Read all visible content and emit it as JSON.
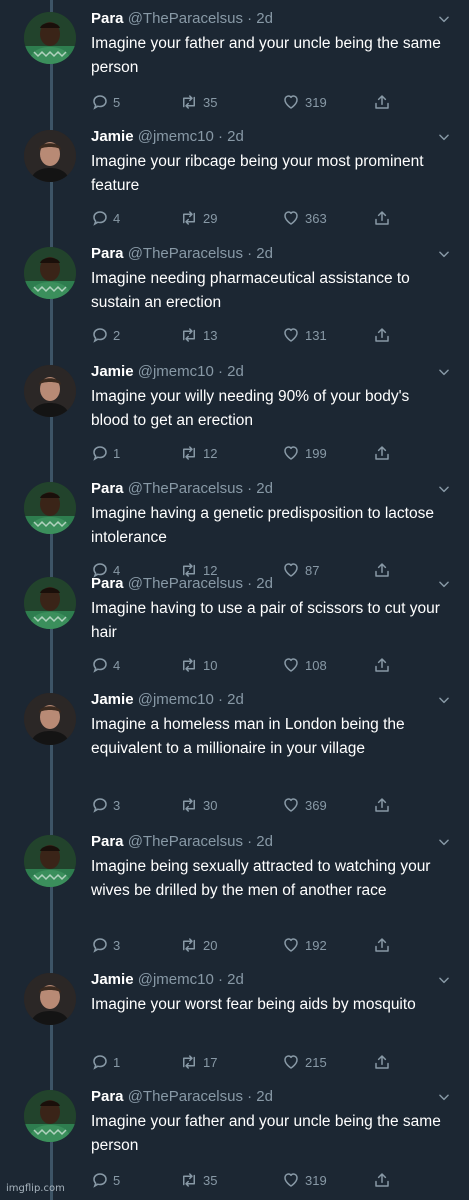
{
  "tweets": [
    {
      "name": "Para",
      "handle": "@TheParacelsus · 2d",
      "text": "Imagine your father and your uncle being the same person",
      "replies": "5",
      "retweets": "35",
      "likes": "319",
      "avatar": "para"
    },
    {
      "name": "Jamie",
      "handle": "@jmemc10 · 2d",
      "text": "Imagine your ribcage being your most prominent feature",
      "replies": "4",
      "retweets": "29",
      "likes": "363",
      "avatar": "jamie"
    },
    {
      "name": "Para",
      "handle": "@TheParacelsus · 2d",
      "text": "Imagine needing pharmaceutical assistance to sustain an erection",
      "replies": "2",
      "retweets": "13",
      "likes": "131",
      "avatar": "para"
    },
    {
      "name": "Jamie",
      "handle": "@jmemc10 · 2d",
      "text": "Imagine your willy needing 90% of your body's blood to get an erection",
      "replies": "1",
      "retweets": "12",
      "likes": "199",
      "avatar": "jamie"
    },
    {
      "name": "Para",
      "handle": "@TheParacelsus · 2d",
      "text": "Imagine having a genetic predisposition to lactose intolerance",
      "replies": "4",
      "retweets": "12",
      "likes": "87",
      "avatar": "para"
    },
    {
      "name": "Para",
      "handle": "@TheParacelsus · 2d",
      "text": "Imagine having to use a pair of scissors to cut your hair",
      "replies": "4",
      "retweets": "10",
      "likes": "108",
      "avatar": "para"
    },
    {
      "name": "Jamie",
      "handle": "@jmemc10 · 2d",
      "text": "Imagine a homeless man in London being the equivalent to a millionaire in your village",
      "replies": "3",
      "retweets": "30",
      "likes": "369",
      "avatar": "jamie"
    },
    {
      "name": "Para",
      "handle": "@TheParacelsus · 2d",
      "text": "Imagine being sexually attracted to watching your wives be drilled by the men of another race",
      "replies": "3",
      "retweets": "20",
      "likes": "192",
      "avatar": "para"
    },
    {
      "name": "Jamie",
      "handle": "@jmemc10 · 2d",
      "text": "Imagine your worst fear being aids by mosquito",
      "replies": "1",
      "retweets": "17",
      "likes": "215",
      "avatar": "jamie"
    },
    {
      "name": "Para",
      "handle": "@TheParacelsus · 2d",
      "text": "Imagine your father and your uncle being the same person",
      "replies": "5",
      "retweets": "35",
      "likes": "319",
      "avatar": "para"
    }
  ],
  "watermark": "imgflip.com",
  "icons": {
    "reply": "reply-icon",
    "retweet": "retweet-icon",
    "like": "heart-icon",
    "share": "share-icon",
    "more": "chevron-down-icon"
  },
  "colors": {
    "background": "#1c2733",
    "muted": "#8899a6",
    "text": "#ffffff",
    "thread_line": "#3d5466"
  }
}
